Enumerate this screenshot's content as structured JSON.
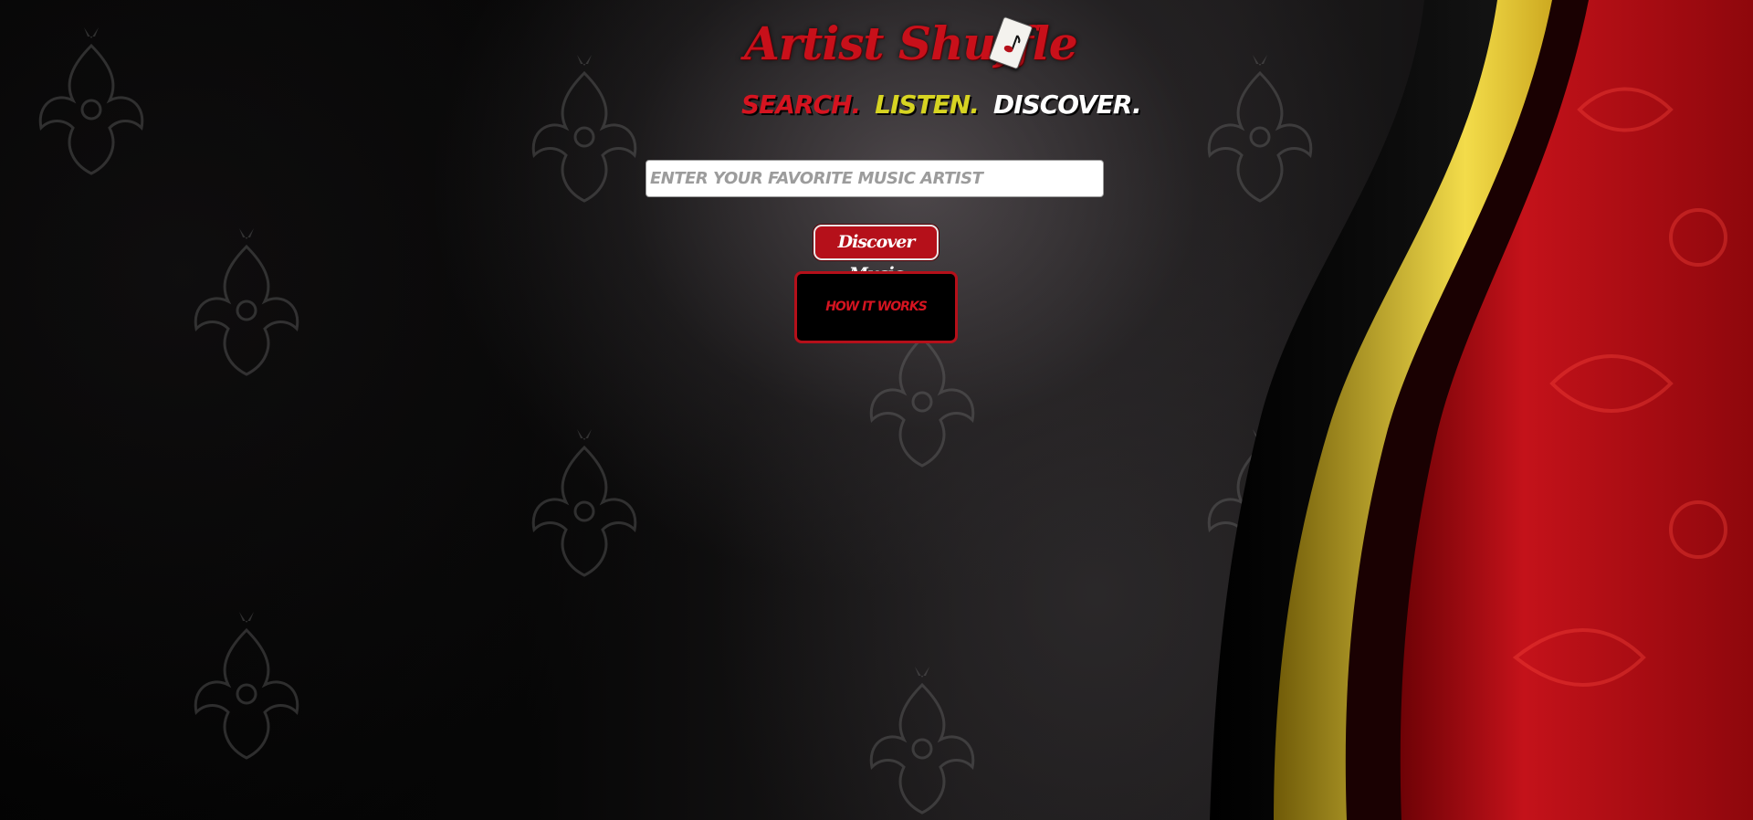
{
  "app": {
    "title": "Artist Shuffle",
    "logo_icon": "music-note-card-icon"
  },
  "tagline": {
    "search": "SEARCH.",
    "listen": "LISTEN.",
    "discover": "DISCOVER."
  },
  "search": {
    "placeholder": "ENTER YOUR FAVORITE MUSIC ARTIST",
    "value": ""
  },
  "actions": {
    "discover_label": "Discover Music",
    "how_label": "HOW IT WORKS"
  },
  "colors": {
    "accent_red": "#c8101a",
    "accent_yellow": "#d7d422",
    "white": "#ffffff",
    "background": "#000000"
  }
}
